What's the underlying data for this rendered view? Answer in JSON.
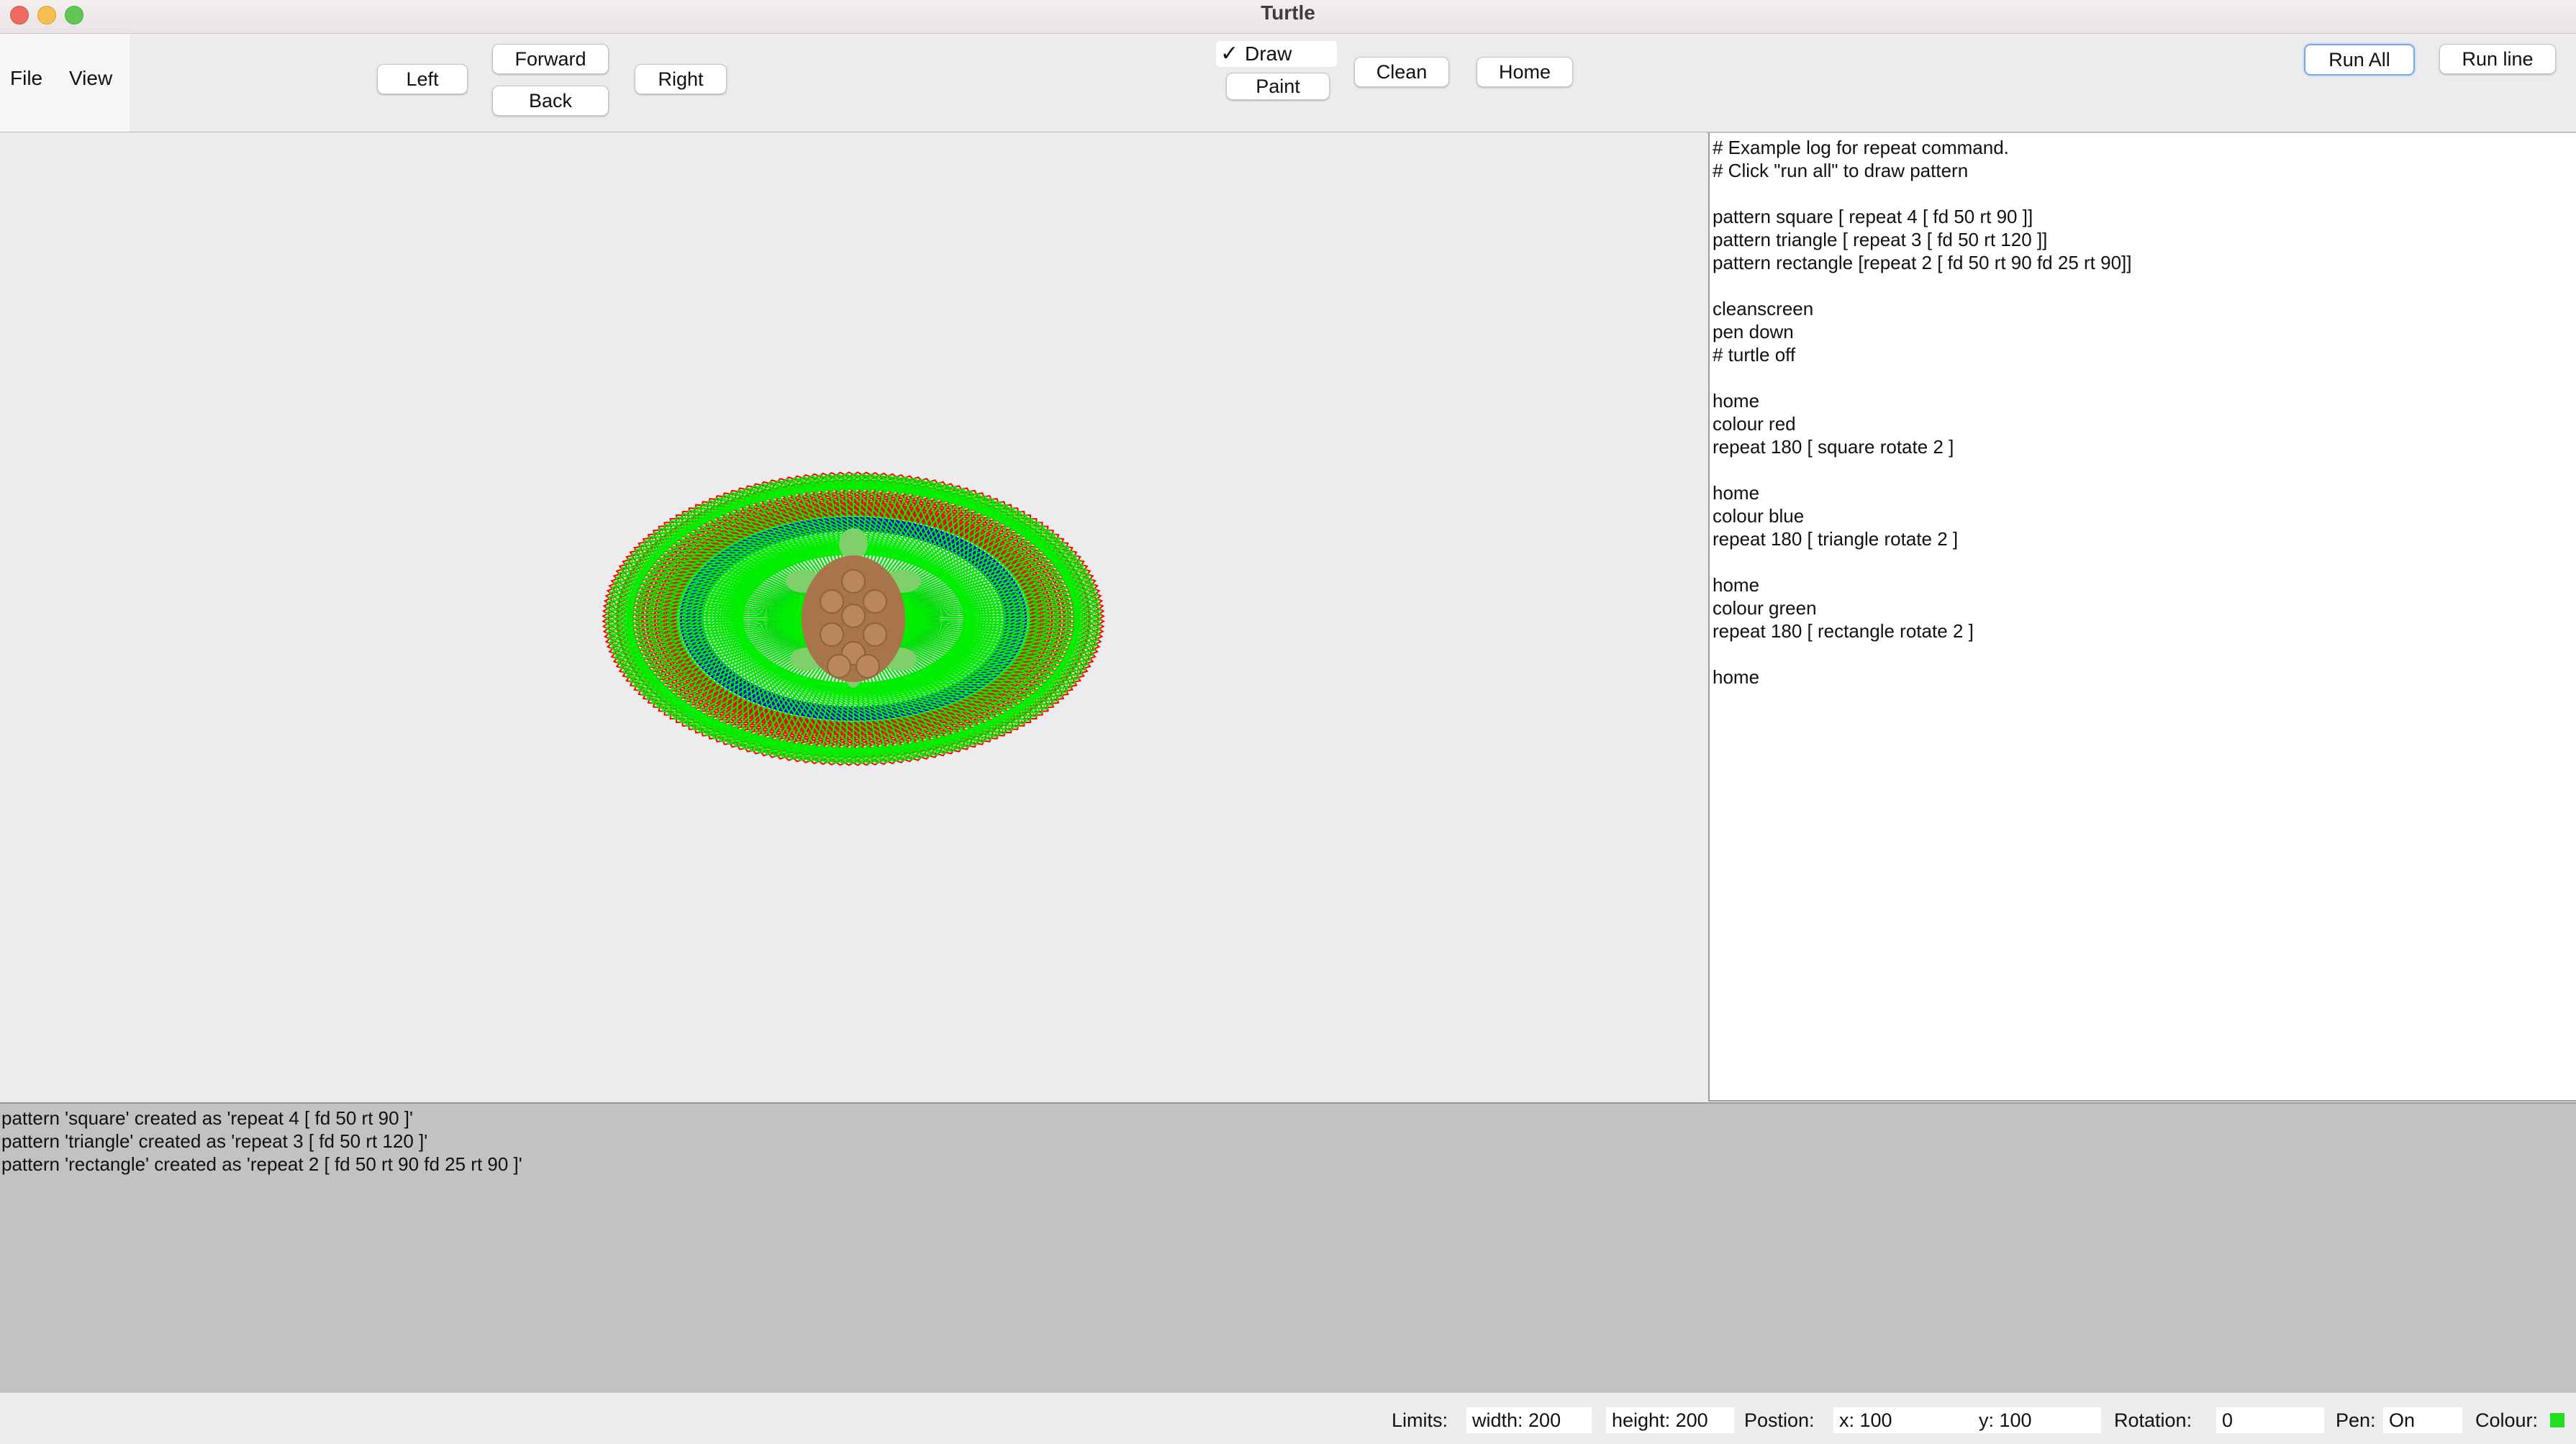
{
  "window": {
    "title": "Turtle"
  },
  "menu": {
    "file": "File",
    "view": "View"
  },
  "toolbar": {
    "left": "Left",
    "forward": "Forward",
    "back": "Back",
    "right": "Right",
    "draw_check": "✓",
    "draw": "Draw",
    "paint": "Paint",
    "clean": "Clean",
    "home": "Home",
    "run_all": "Run All",
    "run_line": "Run line"
  },
  "editor": {
    "lines": [
      "# Example log for repeat command.",
      "# Click \"run all\" to draw pattern",
      "",
      "pattern square [ repeat 4 [ fd 50 rt 90 ]]",
      "pattern triangle [ repeat 3 [ fd 50 rt 120 ]]",
      "pattern rectangle [repeat 2 [ fd 50 rt 90 fd 25 rt 90]]",
      "",
      "cleanscreen",
      "pen down",
      "# turtle off",
      "",
      "home",
      "colour red",
      "repeat 180 [ square rotate 2 ]",
      "",
      "home",
      "colour blue",
      "repeat 180 [ triangle rotate 2 ]",
      "",
      "home",
      "colour green",
      "repeat 180 [ rectangle rotate 2 ]",
      "",
      "home"
    ]
  },
  "output": {
    "lines": [
      "pattern 'square' created as 'repeat 4 [ fd 50 rt 90 ]'",
      "pattern 'triangle' created as 'repeat 3 [ fd 50 rt 120 ]'",
      "pattern 'rectangle' created as 'repeat 2 [ fd 50 rt 90 fd 25 rt 90 ]'"
    ]
  },
  "status": {
    "limits_label": "Limits:",
    "width": "width: 200",
    "height": "height: 200",
    "position_label": "Postion:",
    "x": "x: 100",
    "y": "y: 100",
    "rotation_label": "Rotation:",
    "rotation": "0",
    "pen_label": "Pen:",
    "pen": "On",
    "colour_label": "Colour:",
    "colour_value": "#22dd22"
  },
  "drawing": {
    "colors": {
      "red": "#ff0000",
      "blue": "#0000ee",
      "green": "#00ee00",
      "turtle_shell": "#a8754a",
      "turtle_body": "#7fcf6a"
    },
    "patterns": [
      {
        "name": "square",
        "colour": "red",
        "repeat": 180,
        "rotate": 2
      },
      {
        "name": "triangle",
        "colour": "blue",
        "repeat": 180,
        "rotate": 2
      },
      {
        "name": "rectangle",
        "colour": "green",
        "repeat": 180,
        "rotate": 2
      }
    ]
  }
}
